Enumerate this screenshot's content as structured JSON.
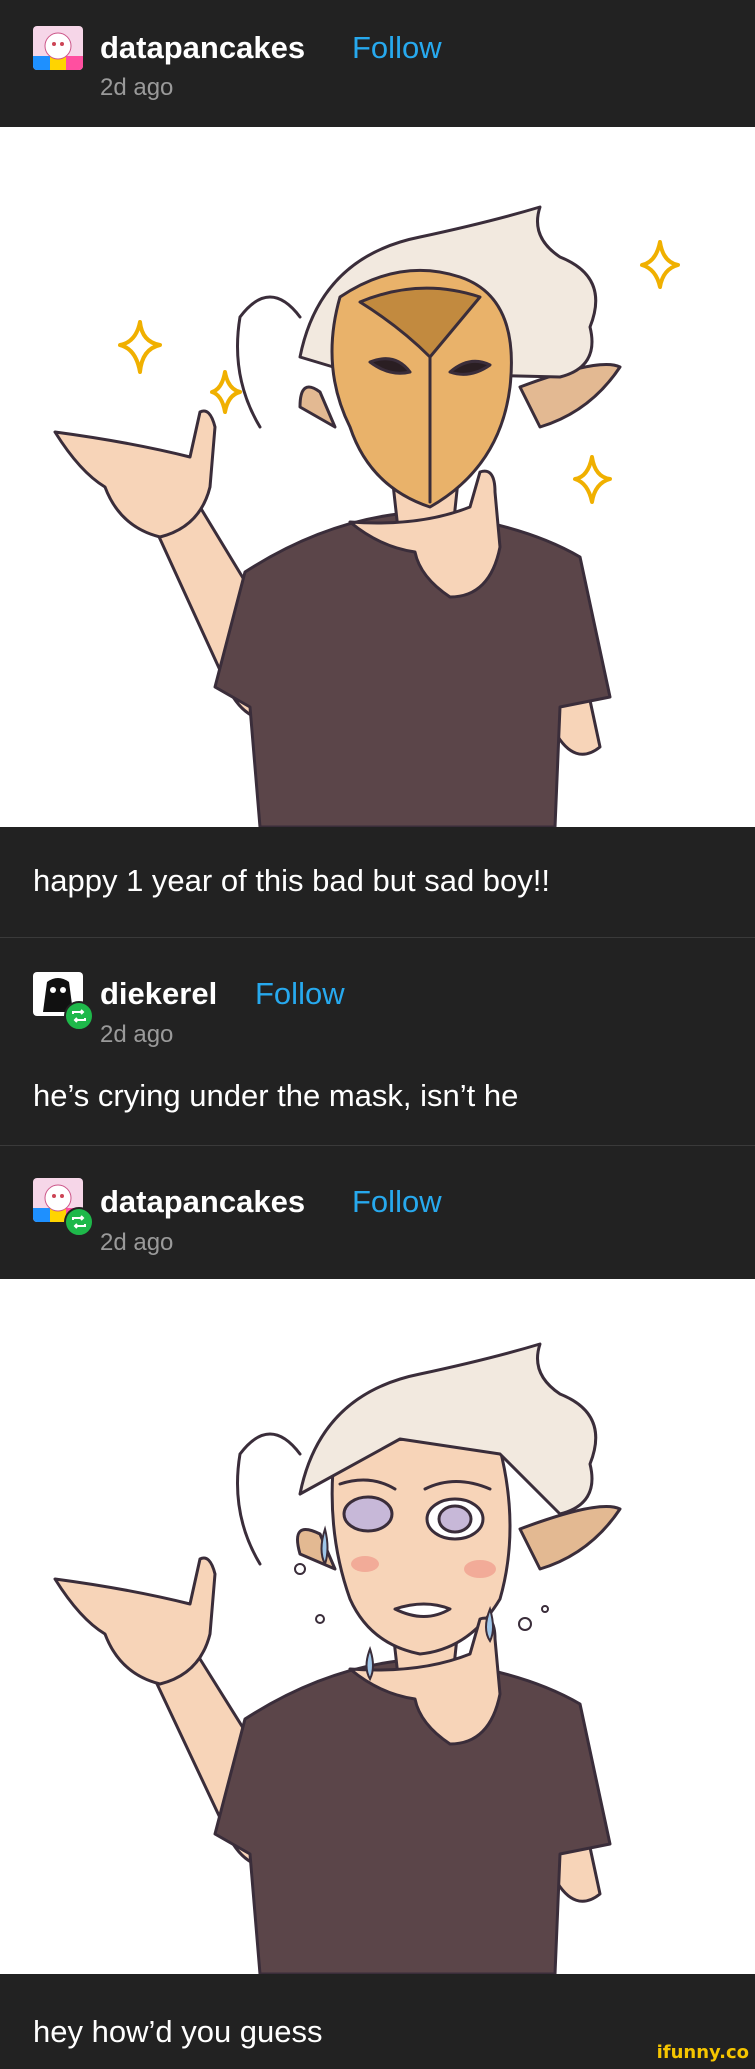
{
  "posts": [
    {
      "username": "datapancakes",
      "follow": "Follow",
      "time": "2d ago",
      "text": "happy 1 year of this bad but sad boy!!"
    },
    {
      "username": "diekerel",
      "follow": "Follow",
      "time": "2d ago",
      "text": "he’s crying under the mask, isn’t he"
    },
    {
      "username": "datapancakes",
      "follow": "Follow",
      "time": "2d ago",
      "text": "hey how’d you guess"
    }
  ],
  "watermark": "ifunny.co",
  "colors": {
    "background": "#222222",
    "follow": "#27a9ee",
    "reblog_badge": "#1eb84a",
    "watermark": "#f5c500"
  }
}
